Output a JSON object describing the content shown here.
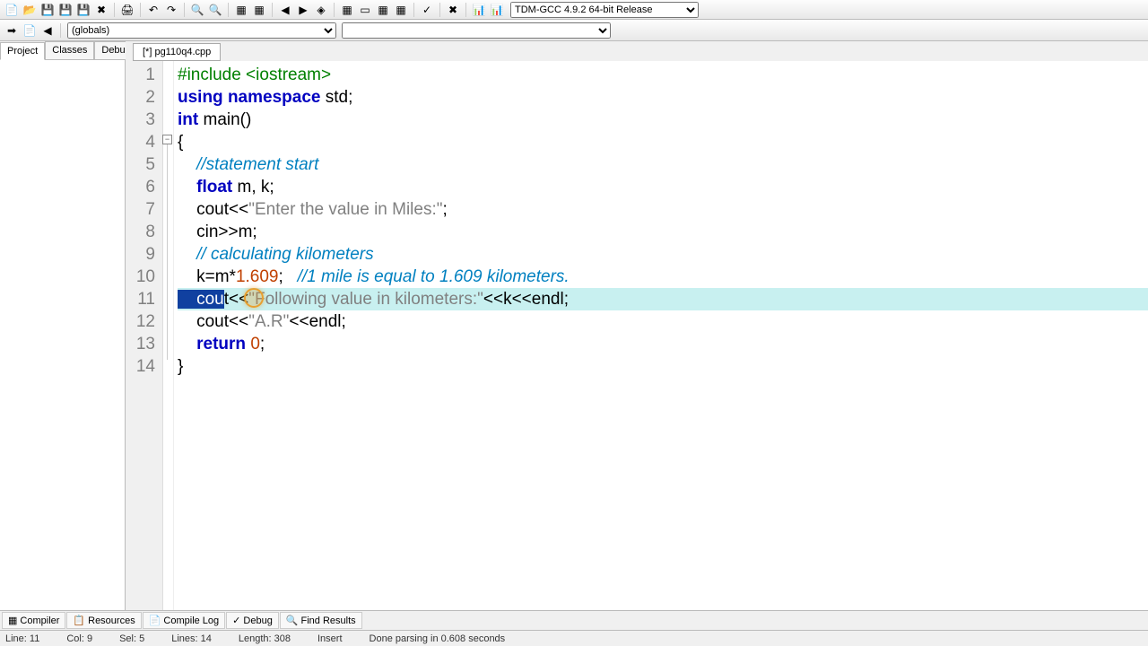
{
  "toolbar": {
    "compiler_select": "TDM-GCC 4.9.2 64-bit Release"
  },
  "toolbar2": {
    "scope": "(globals)"
  },
  "side": {
    "tabs": [
      "Project",
      "Classes",
      "Debug"
    ],
    "active": 0
  },
  "file_tab": "[*] pg110q4.cpp",
  "code": {
    "lines": [
      {
        "n": "1"
      },
      {
        "n": "2"
      },
      {
        "n": "3"
      },
      {
        "n": "4"
      },
      {
        "n": "5"
      },
      {
        "n": "6"
      },
      {
        "n": "7"
      },
      {
        "n": "8"
      },
      {
        "n": "9"
      },
      {
        "n": "10"
      },
      {
        "n": "11"
      },
      {
        "n": "12"
      },
      {
        "n": "13"
      },
      {
        "n": "14"
      }
    ],
    "l1_include": "#include <iostream>",
    "l2_using": "using",
    "l2_namespace": "namespace",
    "l2_std": " std;",
    "l3_int": "int",
    "l3_main": " main()",
    "l4": "{",
    "l5_indent": "    ",
    "l5_com": "//statement start",
    "l6_indent": "    ",
    "l6_float": "float",
    "l6_rest": " m, k;",
    "l7_indent": "    cout<<",
    "l7_str": "\"Enter the value in Miles:\"",
    "l7_end": ";",
    "l8": "    cin>>m;",
    "l9_indent": "    ",
    "l9_com": "// calculating kilometers",
    "l10_a": "    k=m*",
    "l10_num": "1.609",
    "l10_b": ";   ",
    "l10_com": "//1 mile is equal to 1.609 kilometers.",
    "l11_sel": "    cou",
    "l11_a": "t<<",
    "l11_str": "\"Following value in kilometers:\"",
    "l11_b": "<<k<<endl;",
    "l12_a": "    cout<<",
    "l12_str": "\"A.R\"",
    "l12_b": "<<endl;",
    "l13_indent": "    ",
    "l13_return": "return",
    "l13_sp": " ",
    "l13_num": "0",
    "l13_end": ";",
    "l14": "}"
  },
  "bottom_tabs": {
    "compiler": "Compiler",
    "resources": "Resources",
    "compile_log": "Compile Log",
    "debug": "Debug",
    "find": "Find Results"
  },
  "status": {
    "line": "Line:   11",
    "col": "Col:   9",
    "sel": "Sel:   5",
    "lines": "Lines:   14",
    "length": "Length:   308",
    "mode": "Insert",
    "msg": "Done parsing in 0.608 seconds"
  }
}
